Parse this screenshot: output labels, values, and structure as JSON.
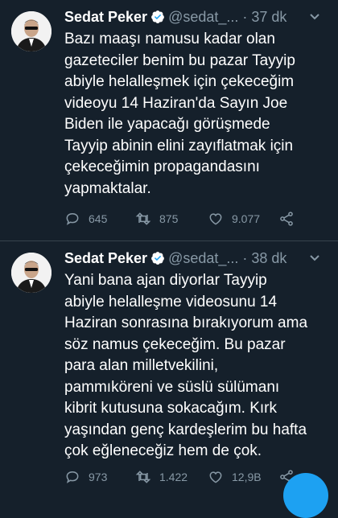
{
  "colors": {
    "background": "#15202b",
    "text": "#ffffff",
    "muted": "#8899a6",
    "accent": "#1da1f2",
    "divider": "#38444d"
  },
  "tweets": [
    {
      "author": "Sedat Peker",
      "handle": "@sedat_...",
      "time": "37 dk",
      "verified": true,
      "text": "Bazı maaşı namusu kadar olan\ngazeteciler benim bu pazar Tayyip\nabiyle helalleşmek için çekeceğim\nvideoyu 14 Haziran'da Sayın Joe\nBiden ile yapacağı görüşmede\nTayyip abinin elini zayıflatmak için\nçekeceğimin propagandasını\nyapmaktalar.",
      "replies": "645",
      "retweets": "875",
      "likes": "9.077",
      "icons": [
        "reply-icon",
        "retweet-icon",
        "like-icon",
        "share-icon",
        "more-icon"
      ]
    },
    {
      "author": "Sedat Peker",
      "handle": "@sedat_...",
      "time": "38 dk",
      "verified": true,
      "text": "Yani bana ajan diyorlar Tayyip\nabiyle helalleşme videosunu 14\nHaziran sonrasına bırakıyorum ama\nsöz namus çekeceğim. Bu pazar\npara alan milletvekilini,\npammıköreni ve süslü sülümanı\nkibrit kutusuna sokacağım.  Kırk\nyaşından genç kardeşlerim bu hafta\nçok eğleneceğiz hem de çok.",
      "replies": "973",
      "retweets": "1.422",
      "likes": "12,9B",
      "icons": [
        "reply-icon",
        "retweet-icon",
        "like-icon",
        "share-icon",
        "more-icon"
      ]
    }
  ]
}
